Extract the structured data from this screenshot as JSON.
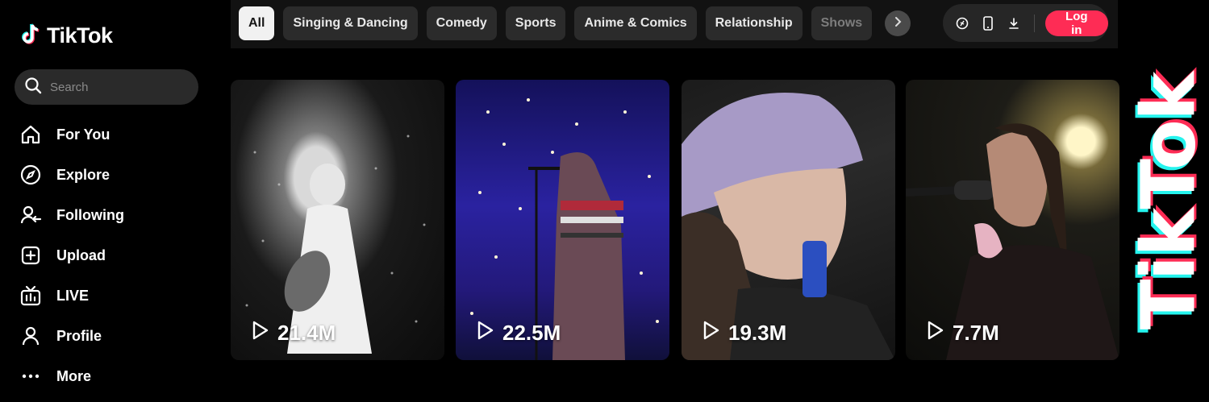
{
  "brand": {
    "name": "TikTok",
    "accent": "#fe2c55",
    "cyan": "#25f4ee"
  },
  "search": {
    "placeholder": "Search"
  },
  "nav": [
    {
      "label": "For You",
      "icon": "home-icon"
    },
    {
      "label": "Explore",
      "icon": "compass-icon"
    },
    {
      "label": "Following",
      "icon": "following-icon"
    },
    {
      "label": "Upload",
      "icon": "upload-icon"
    },
    {
      "label": "LIVE",
      "icon": "live-tv-icon"
    },
    {
      "label": "Profile",
      "icon": "profile-icon"
    },
    {
      "label": "More",
      "icon": "more-dots-icon"
    }
  ],
  "categories": [
    "All",
    "Singing & Dancing",
    "Comedy",
    "Sports",
    "Anime & Comics",
    "Relationship",
    "Shows"
  ],
  "active_category": "All",
  "header_actions": {
    "icons": [
      "effects-house-icon",
      "mobile-app-icon",
      "download-icon"
    ],
    "login_label": "Log in"
  },
  "videos": [
    {
      "views": "21.4M",
      "scene": "singer-with-guitar-bw"
    },
    {
      "views": "22.5M",
      "scene": "concert-purple-lights"
    },
    {
      "views": "19.3M",
      "scene": "girl-lavender-bucket-hat"
    },
    {
      "views": "7.7M",
      "scene": "singer-at-microphone"
    }
  ],
  "watermark": "TikTok"
}
